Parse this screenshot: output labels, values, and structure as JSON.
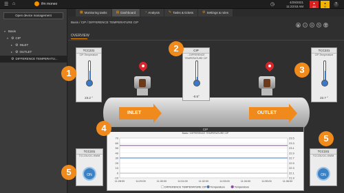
{
  "topbar": {
    "brand": "ifm moneo",
    "date": "4/29/2021",
    "time": "11:23:53 AM",
    "alerts": [
      {
        "color": "#d81e1e",
        "count": "48"
      },
      {
        "color": "#f0b400",
        "count": "6"
      }
    ],
    "help": "?"
  },
  "tabs": [
    {
      "label": "Monitoring tasks",
      "icon": "monitor-icon"
    },
    {
      "label": "Dashboard",
      "icon": "dashboard-icon"
    },
    {
      "label": "Analysis",
      "icon": "analysis-icon"
    },
    {
      "label": "Tasks & tickets",
      "icon": "tasks-icon"
    },
    {
      "label": "Settings & rules",
      "icon": "settings-icon"
    }
  ],
  "sidebar": {
    "open_button": "Open device management",
    "tree": [
      {
        "label": "Basis",
        "level": 0
      },
      {
        "label": "CIP",
        "level": 1
      },
      {
        "label": "INLET",
        "level": 2
      },
      {
        "label": "OUTLET",
        "level": 2
      },
      {
        "label": "DIFFERENCE TEMPERATU...",
        "level": 2,
        "selected": true
      }
    ]
  },
  "main": {
    "breadcrumb": "Basis / CIP / DIFFERENCE TEMPERATURE CIP",
    "overview": "OVERVIEW"
  },
  "widgets": {
    "left": {
      "title": "TCC231",
      "sub": "CIP-Temperature",
      "value": "23.2 °",
      "level": 0.55
    },
    "center": {
      "title": "CIP",
      "sub": "...DIFFERENCE TEMPERATURE CIP",
      "value": "-0.5°",
      "level": 0.2
    },
    "right": {
      "title": "TCC231",
      "sub": "CIP-Temperature",
      "value": "22.7 °",
      "level": 0.55
    },
    "bottom_left": {
      "title": "TCC231",
      "sub": "TCC231/CIC-SWIM",
      "button": "ON"
    },
    "bottom_right": {
      "title": "TCC231",
      "sub": "TCC231/CIC-SWIM",
      "button": "ON"
    }
  },
  "pipe": {
    "inlet": "INLET",
    "outlet": "OUTLET"
  },
  "badges": [
    "1",
    "2",
    "3",
    "4",
    "5",
    "5"
  ],
  "chart_data": {
    "type": "line",
    "title": "CIP",
    "subtitle": "Basis / DIFFERENCE TEMPERATURE CIP",
    "x": [
      "11:28:00",
      "11:29:00",
      "11:30:00",
      "11:31:00",
      "11:32:00",
      "11:33:00",
      "11:34:00",
      "11:35:00",
      "11:36:00"
    ],
    "left_ticks": [
      "70",
      "60",
      "50",
      "40",
      "30",
      "20",
      "10",
      "0",
      "-10"
    ],
    "right_ticks": [
      "23.5",
      "23.3",
      "23.1",
      "22.9",
      "22.7",
      "22.5",
      "22.3",
      "22.1",
      "21.9"
    ],
    "series": [
      {
        "name": "DIFFERENCE TEMPERATURE CIP",
        "color": "#ffffff",
        "values": [
          -0.5,
          -0.5,
          -0.5,
          -0.5,
          -0.5,
          -0.5,
          -0.5,
          -0.5,
          -0.5
        ]
      },
      {
        "name": "Temperature",
        "color": "#3a78c8",
        "values": [
          22.7,
          22.7,
          22.7,
          22.7,
          22.7,
          22.7,
          22.7,
          22.7,
          22.7
        ]
      },
      {
        "name": "Temperature",
        "color": "#8e44ad",
        "values": [
          23.2,
          23.2,
          23.2,
          23.2,
          23.2,
          23.2,
          23.2,
          23.2,
          23.2
        ]
      }
    ]
  }
}
